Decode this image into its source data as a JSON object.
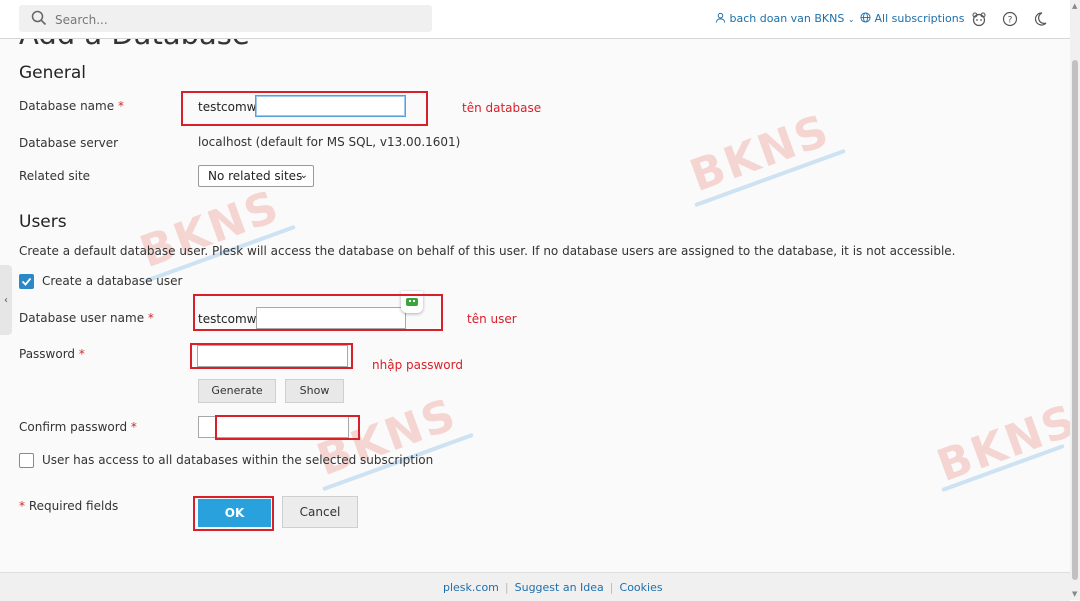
{
  "search": {
    "placeholder": "Search..."
  },
  "header": {
    "user": "bach doan van BKNS",
    "subscriptions": "All subscriptions"
  },
  "page": {
    "title": "Add a Database"
  },
  "general": {
    "heading": "General",
    "db_name_label": "Database name",
    "db_name_prefix": "testcomw_",
    "db_name_value": "",
    "db_server_label": "Database server",
    "db_server_value": "localhost (default for MS SQL, v13.00.1601)",
    "related_site_label": "Related site",
    "related_site_value": "No related sites"
  },
  "users": {
    "heading": "Users",
    "description": "Create a default database user. Plesk will access the database on behalf of this user. If no database users are assigned to the database, it is not accessible.",
    "create_user_label": "Create a database user",
    "create_user_checked": true,
    "user_name_label": "Database user name",
    "user_name_prefix": "testcomw_",
    "user_name_value": "",
    "password_label": "Password",
    "password_value": "",
    "generate_label": "Generate",
    "show_label": "Show",
    "confirm_label": "Confirm password",
    "confirm_value": "",
    "access_all_label": "User has access to all databases within the selected subscription",
    "access_all_checked": false
  },
  "required_star": "*",
  "required_note": "Required fields",
  "buttons": {
    "ok": "OK",
    "cancel": "Cancel"
  },
  "annotations": {
    "db_name": "tên database",
    "user_name": "tên user",
    "password": "nhập password"
  },
  "watermark": "BKNS",
  "footer": {
    "link1": "plesk.com",
    "link2": "Suggest an Idea",
    "link3": "Cookies"
  },
  "colors": {
    "accent": "#28a1dc",
    "annotation": "#d8202a",
    "link": "#1e6faa"
  }
}
